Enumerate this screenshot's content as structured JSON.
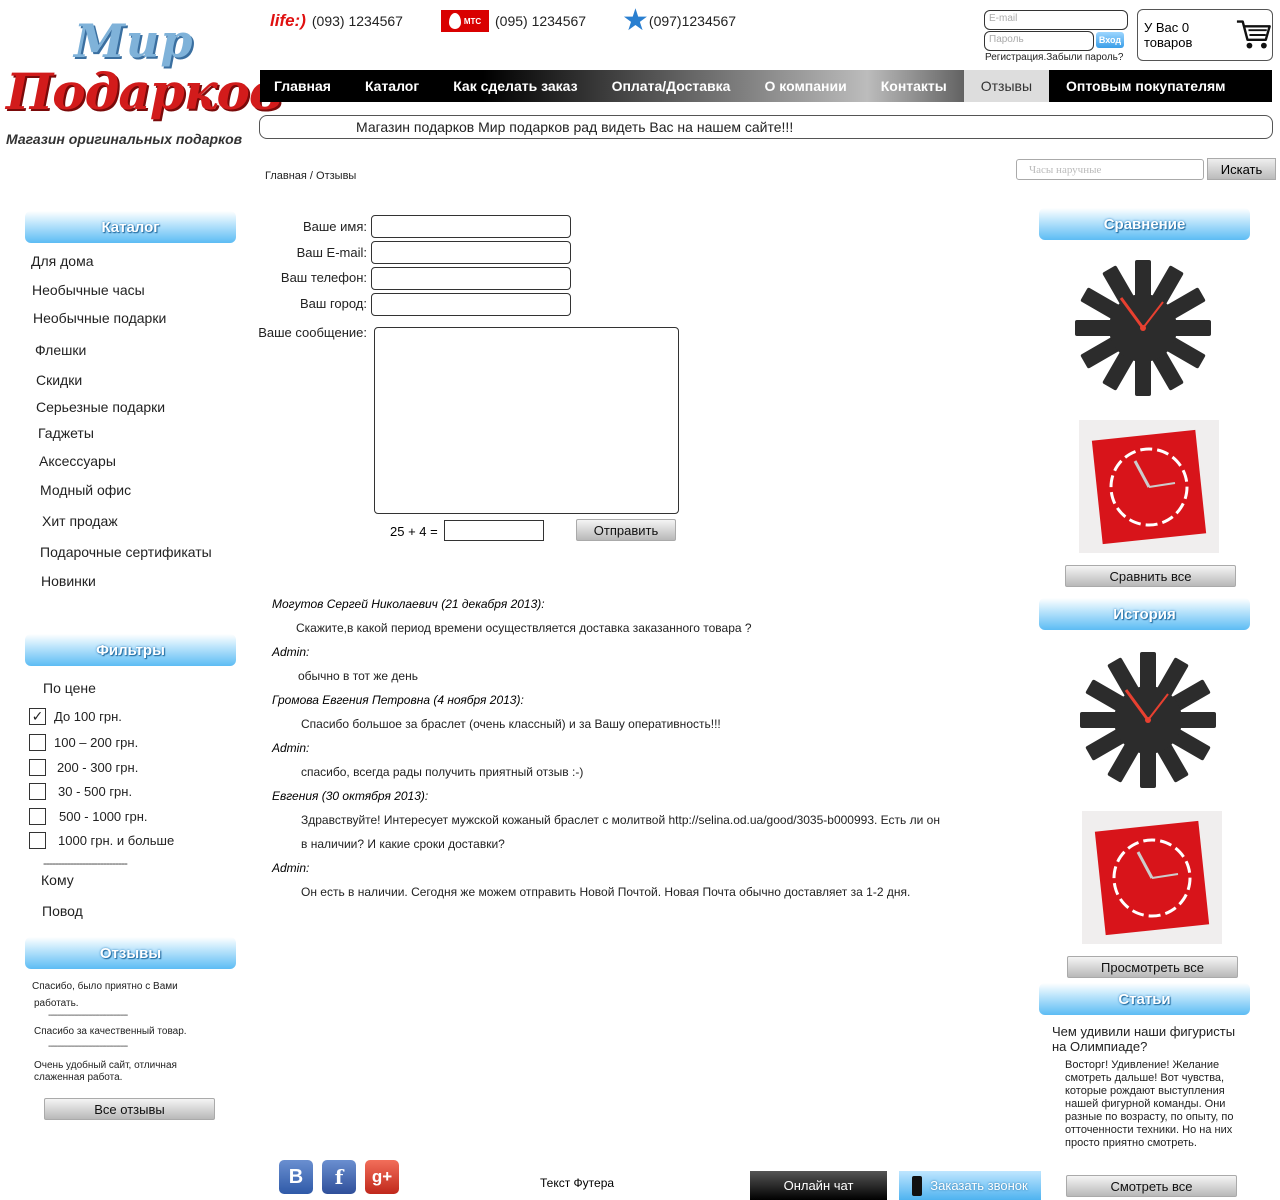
{
  "logo": {
    "line1": "Мир",
    "line2": "Подарков",
    "tagline": "Магазин оригинальных подарков"
  },
  "phones": [
    {
      "operator": "life:)",
      "number": "(093) 1234567"
    },
    {
      "operator": "МТС",
      "number": "(095) 1234567"
    },
    {
      "operator": "kyivstar",
      "number": "(097)1234567"
    }
  ],
  "login": {
    "email_placeholder": "E-mail",
    "password_placeholder": "Пароль",
    "submit": "Вход",
    "register": "Регистрация.",
    "forgot": "Забыли пароль?"
  },
  "cart": {
    "label": "У Вас 0 товаров"
  },
  "nav": [
    "Главная",
    "Каталог",
    "Как сделать заказ",
    "Оплата/Доставка",
    "О компании",
    "Контакты",
    "Отзывы",
    "Оптовым покупателям"
  ],
  "ticker": "Магазин подарков Мир подарков рад видеть Вас на нашем сайте!!!",
  "search": {
    "placeholder": "Часы наручные",
    "button": "Искать"
  },
  "breadcrumb": "Главная / Отзывы",
  "catalog": {
    "title": "Каталог",
    "items": [
      "Для дома",
      "Необычные часы",
      "Необычные подарки",
      "Флешки",
      "Скидки",
      "Серьезные подарки",
      "Гаджеты",
      "Аксессуары",
      "Модный офис",
      "Хит продаж",
      "Подарочные сертификаты",
      "Новинки"
    ]
  },
  "filters": {
    "title": "Фильтры",
    "price_label": "По цене",
    "prices": [
      {
        "label": "До 100 грн.",
        "checked": true
      },
      {
        "label": "100 – 200 грн.",
        "checked": false
      },
      {
        "label": "200 - 300 грн.",
        "checked": false
      },
      {
        "label": "30 - 500 грн.",
        "checked": false
      },
      {
        "label": "500 - 1000 грн.",
        "checked": false
      },
      {
        "label": "1000 грн. и больше",
        "checked": false
      }
    ],
    "separator": "----------------------------",
    "whom": "Кому",
    "occasion": "Повод"
  },
  "side_reviews": {
    "title": "Отзывы",
    "items": [
      "Спасибо, было приятно с Вами",
      "работать.",
      "Спасибо за качественный товар.",
      "Очень удобный сайт, отличная",
      "слаженная работа."
    ],
    "separator": "----------------------------------",
    "button": "Все отзывы"
  },
  "form": {
    "name_label": "Ваше имя:",
    "email_label": "Ваш E-mail:",
    "phone_label": "Ваш телефон:",
    "city_label": "Ваш город:",
    "message_label": "Ваше сообщение:",
    "captcha": "25 + 4 =",
    "submit": "Отправить"
  },
  "reviews": [
    {
      "author": "Могутов Сергей Николаевич (21 декабря 2013):",
      "text": "Скажите,в какой период времени осуществляется доставка заказанного товара ?"
    },
    {
      "author": "Admin:",
      "text": "обычно в тот же день"
    },
    {
      "author": "Громова Евгения Петровна (4 ноября 2013):",
      "text": "Спасибо большое за браслет (очень классный) и за Вашу оперативность!!!"
    },
    {
      "author": "Admin:",
      "text": "спасибо, всегда рады получить приятный отзыв :-)"
    },
    {
      "author": "Евгения (30 октября 2013):",
      "text": "Здравствуйте! Интересует мужской кожаный браслет с молитвой http://selina.od.ua/good/3035-b000993. Есть ли он",
      "text2": "в наличии? И какие сроки доставки?"
    },
    {
      "author": "Admin:",
      "text": "Он есть в наличии. Сегодня же можем отправить Новой Почтой. Новая Почта обычно доставляет за 1-2 дня."
    }
  ],
  "compare": {
    "title": "Сравнение",
    "button": "Сравнить все"
  },
  "history": {
    "title": "История",
    "button": "Просмотреть все"
  },
  "articles": {
    "title": "Статьи",
    "heading": "Чем удивили наши фигуристы на Олимпиаде?",
    "text": "Восторг! Удивление! Желание смотреть дальше! Вот чувства, которые рождают выступления нашей фигурной команды. Они разные по возрасту, по опыту, по отточенности техники. Но на них просто приятно смотреть.",
    "button": "Смотреть все"
  },
  "footer": {
    "text": "Текст Футера",
    "online_chat": "Онлайн чат",
    "callback": "Заказать звонок",
    "social": [
      "vk-icon",
      "facebook-icon",
      "google-plus-icon"
    ]
  },
  "colors": {
    "accent_blue": "#5dbcf4",
    "brand_red": "#d21b1b"
  }
}
